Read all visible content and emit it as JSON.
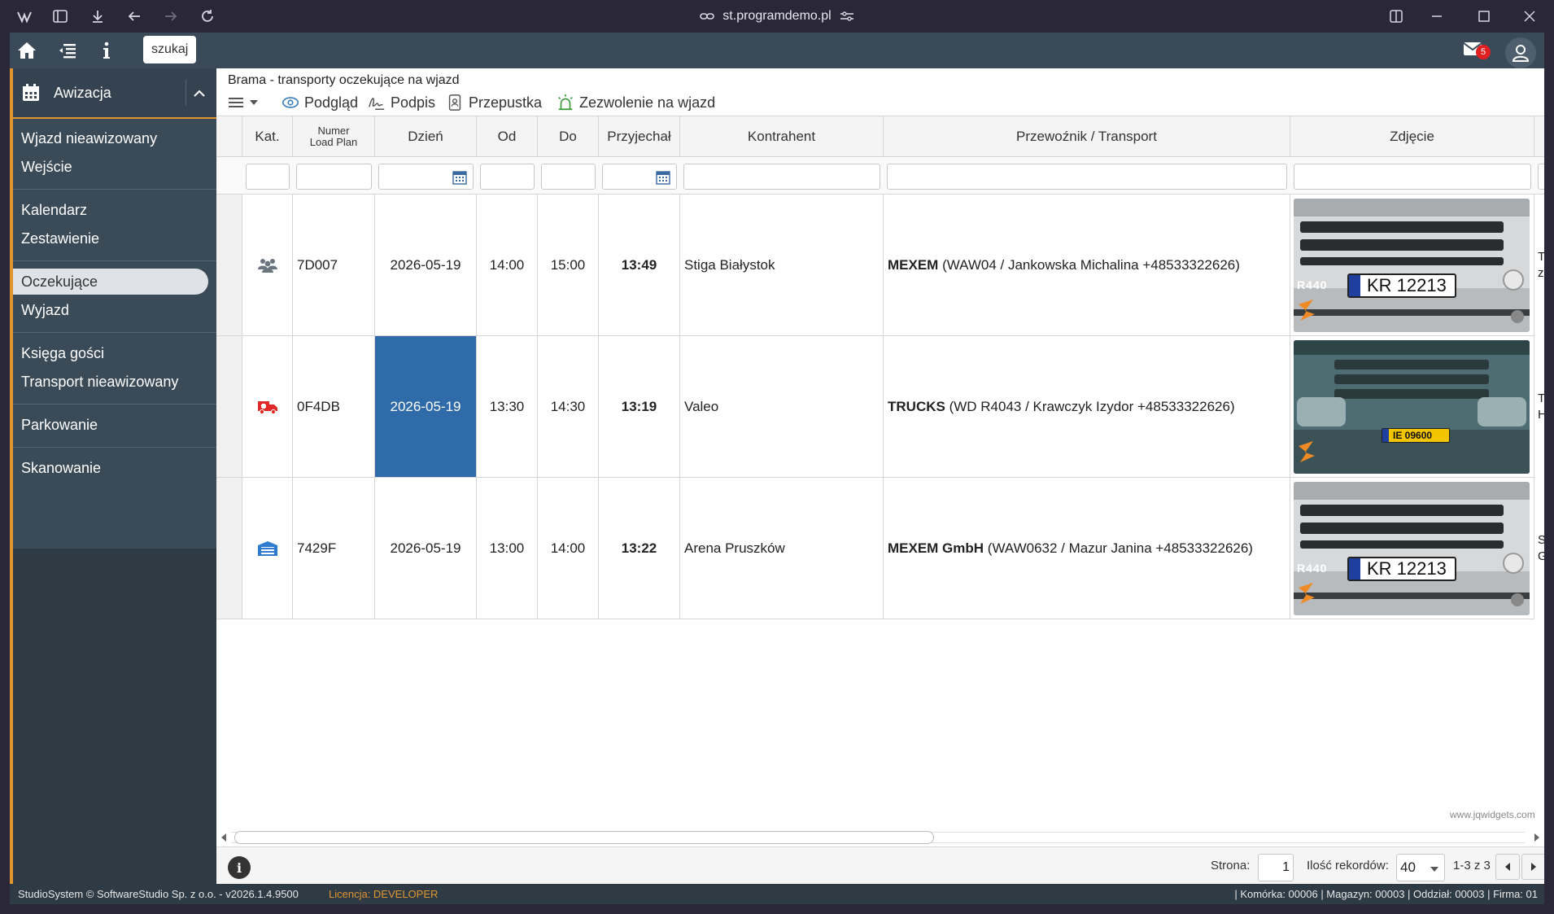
{
  "browser": {
    "url": "st.programdemo.pl"
  },
  "topbar": {
    "search_label": "szukaj",
    "mail_count": "5"
  },
  "sidebar": {
    "header": "Awizacja",
    "items": [
      {
        "label": "Wjazd nieawizowany"
      },
      {
        "label": "Wejście"
      },
      {
        "label": "Kalendarz"
      },
      {
        "label": "Zestawienie"
      },
      {
        "label": "Oczekujące"
      },
      {
        "label": "Wyjazd"
      },
      {
        "label": "Księga gości"
      },
      {
        "label": "Transport nieawizowany"
      },
      {
        "label": "Parkowanie"
      },
      {
        "label": "Skanowanie"
      }
    ],
    "active": "Oczekujące"
  },
  "content": {
    "breadcrumb": "Brama - transporty oczekujące na wjazd",
    "toolbar": {
      "preview": "Podgląd",
      "sign": "Podpis",
      "pass": "Przepustka",
      "permit": "Zezwolenie na wjazd"
    },
    "columns": {
      "cat": "Kat.",
      "loadplan_1": "Numer",
      "loadplan_2": "Load Plan",
      "day": "Dzień",
      "from": "Od",
      "to": "Do",
      "arrived": "Przyjechał",
      "contractor": "Kontrahent",
      "carrier": "Przewoźnik / Transport",
      "photo": "Zdjęcie"
    },
    "rows": [
      {
        "category_icon": "people-icon",
        "loadplan": "7D007",
        "day": "2026-05-19",
        "from": "14:00",
        "to": "15:00",
        "arrived": "13:49",
        "contractor": "Stiga Białystok",
        "carrier_bold": "MEXEM",
        "carrier_rest": " (WAW04 / Jankowska Michalina +48533322626)",
        "plate": "KR 12213",
        "model": "R440",
        "cut": "T",
        "cut2": "z"
      },
      {
        "category_icon": "ambulance-icon",
        "loadplan": "0F4DB",
        "day": "2026-05-19",
        "from": "13:30",
        "to": "14:30",
        "arrived": "13:19",
        "contractor": "Valeo",
        "carrier_bold": "TRUCKS",
        "carrier_rest": " (WD R4043 / Krawczyk Izydor +48533322626)",
        "plate": "IE 09600",
        "model": "",
        "cut": "T",
        "cut2": "H"
      },
      {
        "category_icon": "warehouse-icon",
        "loadplan": "7429F",
        "day": "2026-05-19",
        "from": "13:00",
        "to": "14:00",
        "arrived": "13:22",
        "contractor": "Arena Pruszków",
        "carrier_bold": "MEXEM GmbH",
        "carrier_rest": " (WAW0632 / Mazur Janina +48533322626)",
        "plate": "KR 12213",
        "model": "R440",
        "cut": "S",
        "cut2": "G"
      }
    ],
    "watermark": "www.jqwidgets.com"
  },
  "pager": {
    "page_label": "Strona:",
    "page_value": "1",
    "records_label": "Ilość rekordów:",
    "records_value": "40",
    "range": "1-3 z 3"
  },
  "status": {
    "left": "StudioSystem © SoftwareStudio Sp. z o.o. - v2026.1.4.9500",
    "license_label": "Licencja: ",
    "license_value": "DEVELOPER",
    "right": "| Komórka: 00006 | Magazyn: 00003 | Oddział: 00003 | Firma: 01"
  },
  "colors": {
    "accent": "#e0952f",
    "sidebar": "#3b4a57",
    "selected": "#2f6ba8"
  }
}
